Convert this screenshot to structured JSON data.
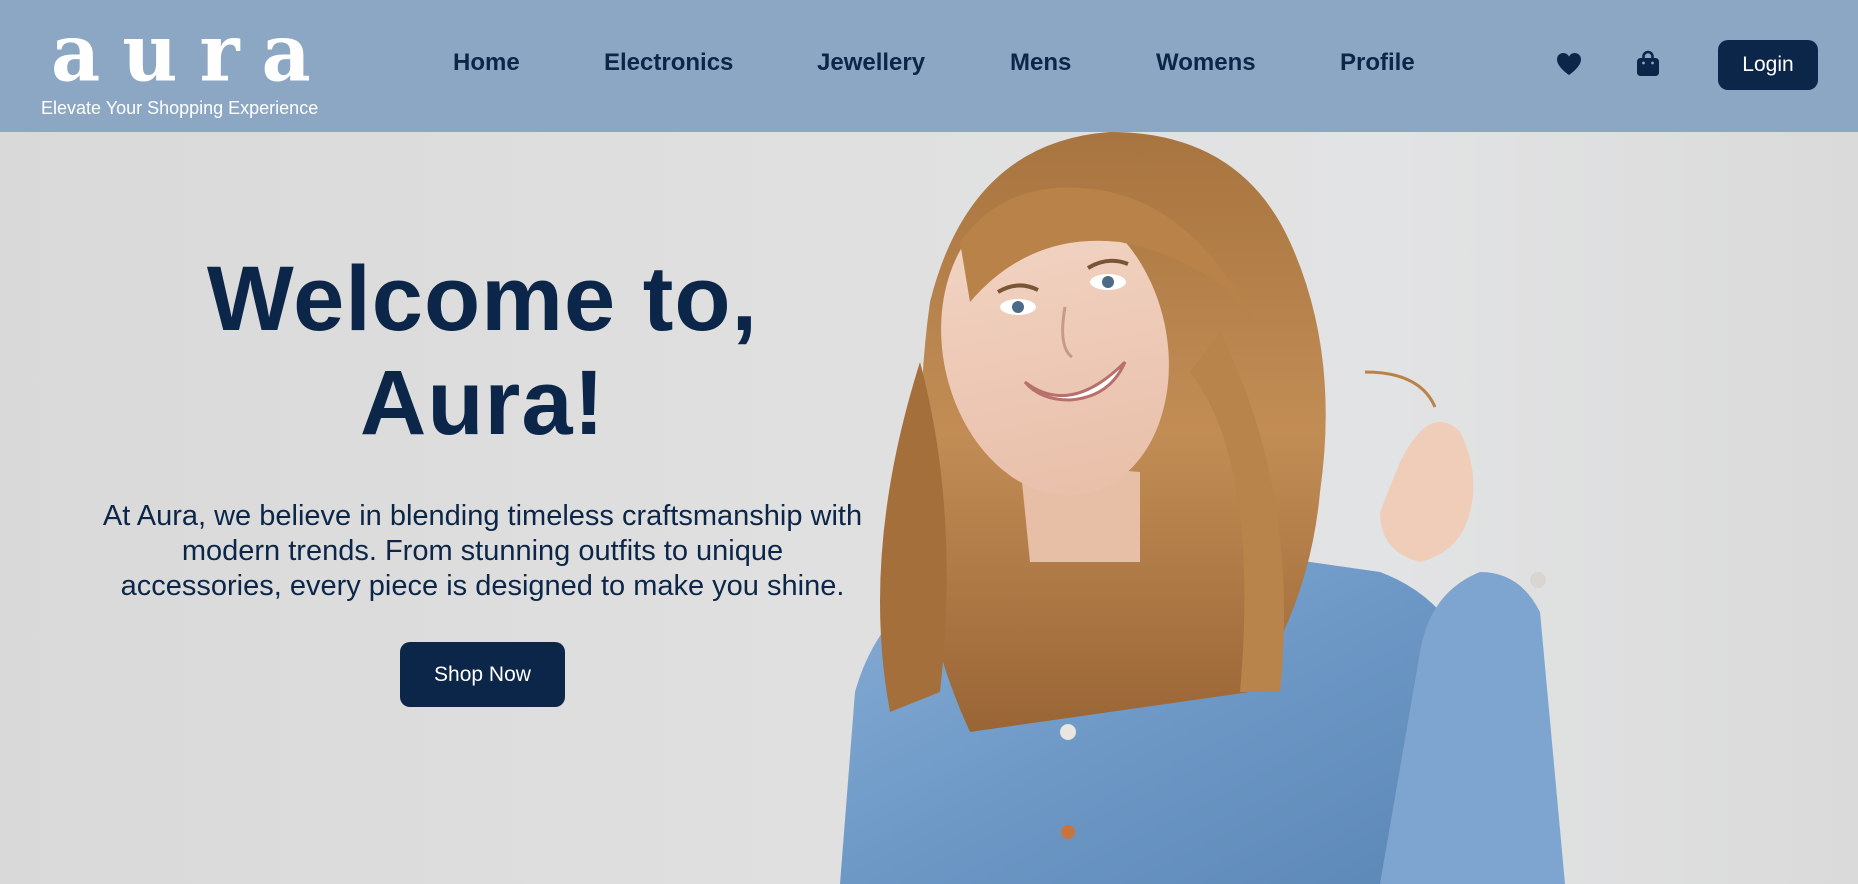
{
  "brand": {
    "logo": "aura",
    "tagline": "Elevate Your Shopping Experience"
  },
  "nav": {
    "links": [
      "Home",
      "Electronics",
      "Jewellery",
      "Mens",
      "Womens",
      "Profile"
    ],
    "icons": [
      "heart-icon",
      "shopping-bag-icon"
    ],
    "login_label": "Login"
  },
  "hero": {
    "title_line1": "Welcome to,",
    "title_line2": "Aura!",
    "description": "At Aura, we believe in blending timeless craftsmanship with modern trends. From stunning outfits to unique accessories, every piece is designed to make you shine.",
    "cta_label": "Shop Now"
  },
  "colors": {
    "navbar_bg": "#8ba7c4",
    "primary": "#0c2649",
    "hero_bg": "#dcdcdc",
    "denim": "#6f9bc9",
    "hair": "#b07a44"
  }
}
